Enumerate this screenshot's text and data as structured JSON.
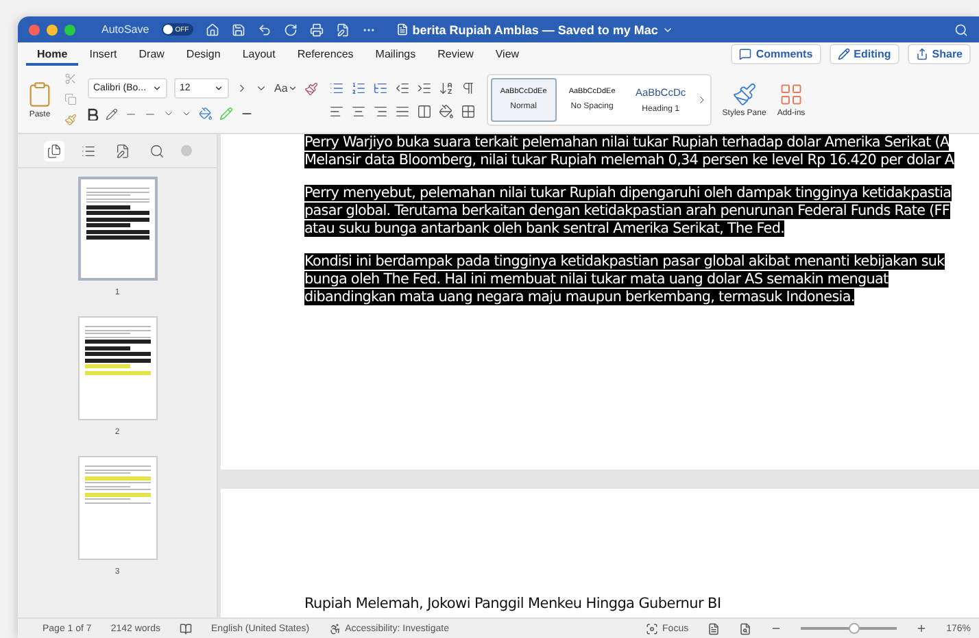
{
  "title_bar": {
    "autosave_label": "AutoSave",
    "autosave_toggle": {
      "on": false,
      "label": "OFF"
    },
    "document_title": "berita Rupiah Amblas — Saved to my Mac"
  },
  "menu_tabs": [
    {
      "label": "Home",
      "selected": true
    },
    {
      "label": "Insert",
      "selected": false
    },
    {
      "label": "Draw",
      "selected": false
    },
    {
      "label": "Design",
      "selected": false
    },
    {
      "label": "Layout",
      "selected": false
    },
    {
      "label": "References",
      "selected": false
    },
    {
      "label": "Mailings",
      "selected": false
    },
    {
      "label": "Review",
      "selected": false
    },
    {
      "label": "View",
      "selected": false
    }
  ],
  "actions": [
    {
      "label": "Comments",
      "kind": "comments"
    },
    {
      "label": "Editing",
      "kind": "editing"
    },
    {
      "label": "Share",
      "kind": "share"
    }
  ],
  "ribbon": {
    "paste_label": "Paste",
    "font_name": "Calibri (Bo...",
    "font_size": "12",
    "change_case": "Aa",
    "styles": [
      {
        "sample": "AaBbCcDdEe",
        "name": "Normal",
        "selected": true,
        "kind": "body"
      },
      {
        "sample": "AaBbCcDdEe",
        "name": "No Spacing",
        "selected": false,
        "kind": "body"
      },
      {
        "sample": "AaBbCcDc",
        "name": "Heading 1",
        "selected": false,
        "kind": "heading"
      }
    ],
    "styles_pane_label": "Styles Pane",
    "addins_label": "Add-ins"
  },
  "sidebar": {
    "tabs": [
      {
        "kind": "thumbnails",
        "selected": true
      },
      {
        "kind": "outline",
        "selected": false
      },
      {
        "kind": "comments",
        "selected": false
      },
      {
        "kind": "search",
        "selected": false
      }
    ],
    "pages": [
      {
        "number": "1",
        "selected": true
      },
      {
        "number": "2",
        "selected": false
      },
      {
        "number": "3",
        "selected": false
      }
    ]
  },
  "document": {
    "paragraphs": [
      {
        "highlighted": true,
        "lines": [
          "Perry Warjiyo buka suara terkait pelemahan nilai tukar Rupiah terhadap dolar Amerika Serikat (A",
          "Melansir data Bloomberg, nilai tukar Rupiah melemah 0,34 persen ke level Rp 16.420 per dolar A"
        ]
      },
      {
        "highlighted": true,
        "lines": [
          "Perry menyebut, pelemahan nilai tukar Rupiah dipengaruhi oleh dampak tingginya ketidakpastia",
          "pasar global. Terutama berkaitan dengan ketidakpastian arah penurunan Federal Funds Rate (FF",
          "atau suku bunga antarbank oleh bank sentral Amerika Serikat, The Fed."
        ]
      },
      {
        "highlighted": true,
        "lines": [
          "Kondisi ini berdampak pada tingginya ketidakpastian pasar global akibat menanti kebijakan suk",
          "bunga oleh The Fed. Hal ini membuat nilai tukar mata uang dolar AS semakin menguat",
          "dibandingkan mata uang negara maju maupun berkembang, termasuk Indonesia."
        ]
      }
    ],
    "heading": "Rupiah Melemah, Jokowi Panggil Menkeu Hingga Gubernur BI"
  },
  "status_bar": {
    "page": "Page 1 of 7",
    "words": "2142 words",
    "language": "English (United States)",
    "accessibility": "Accessibility: Investigate",
    "focus": "Focus",
    "zoom_slider": {
      "level": 0.55
    },
    "zoom": "176%"
  }
}
